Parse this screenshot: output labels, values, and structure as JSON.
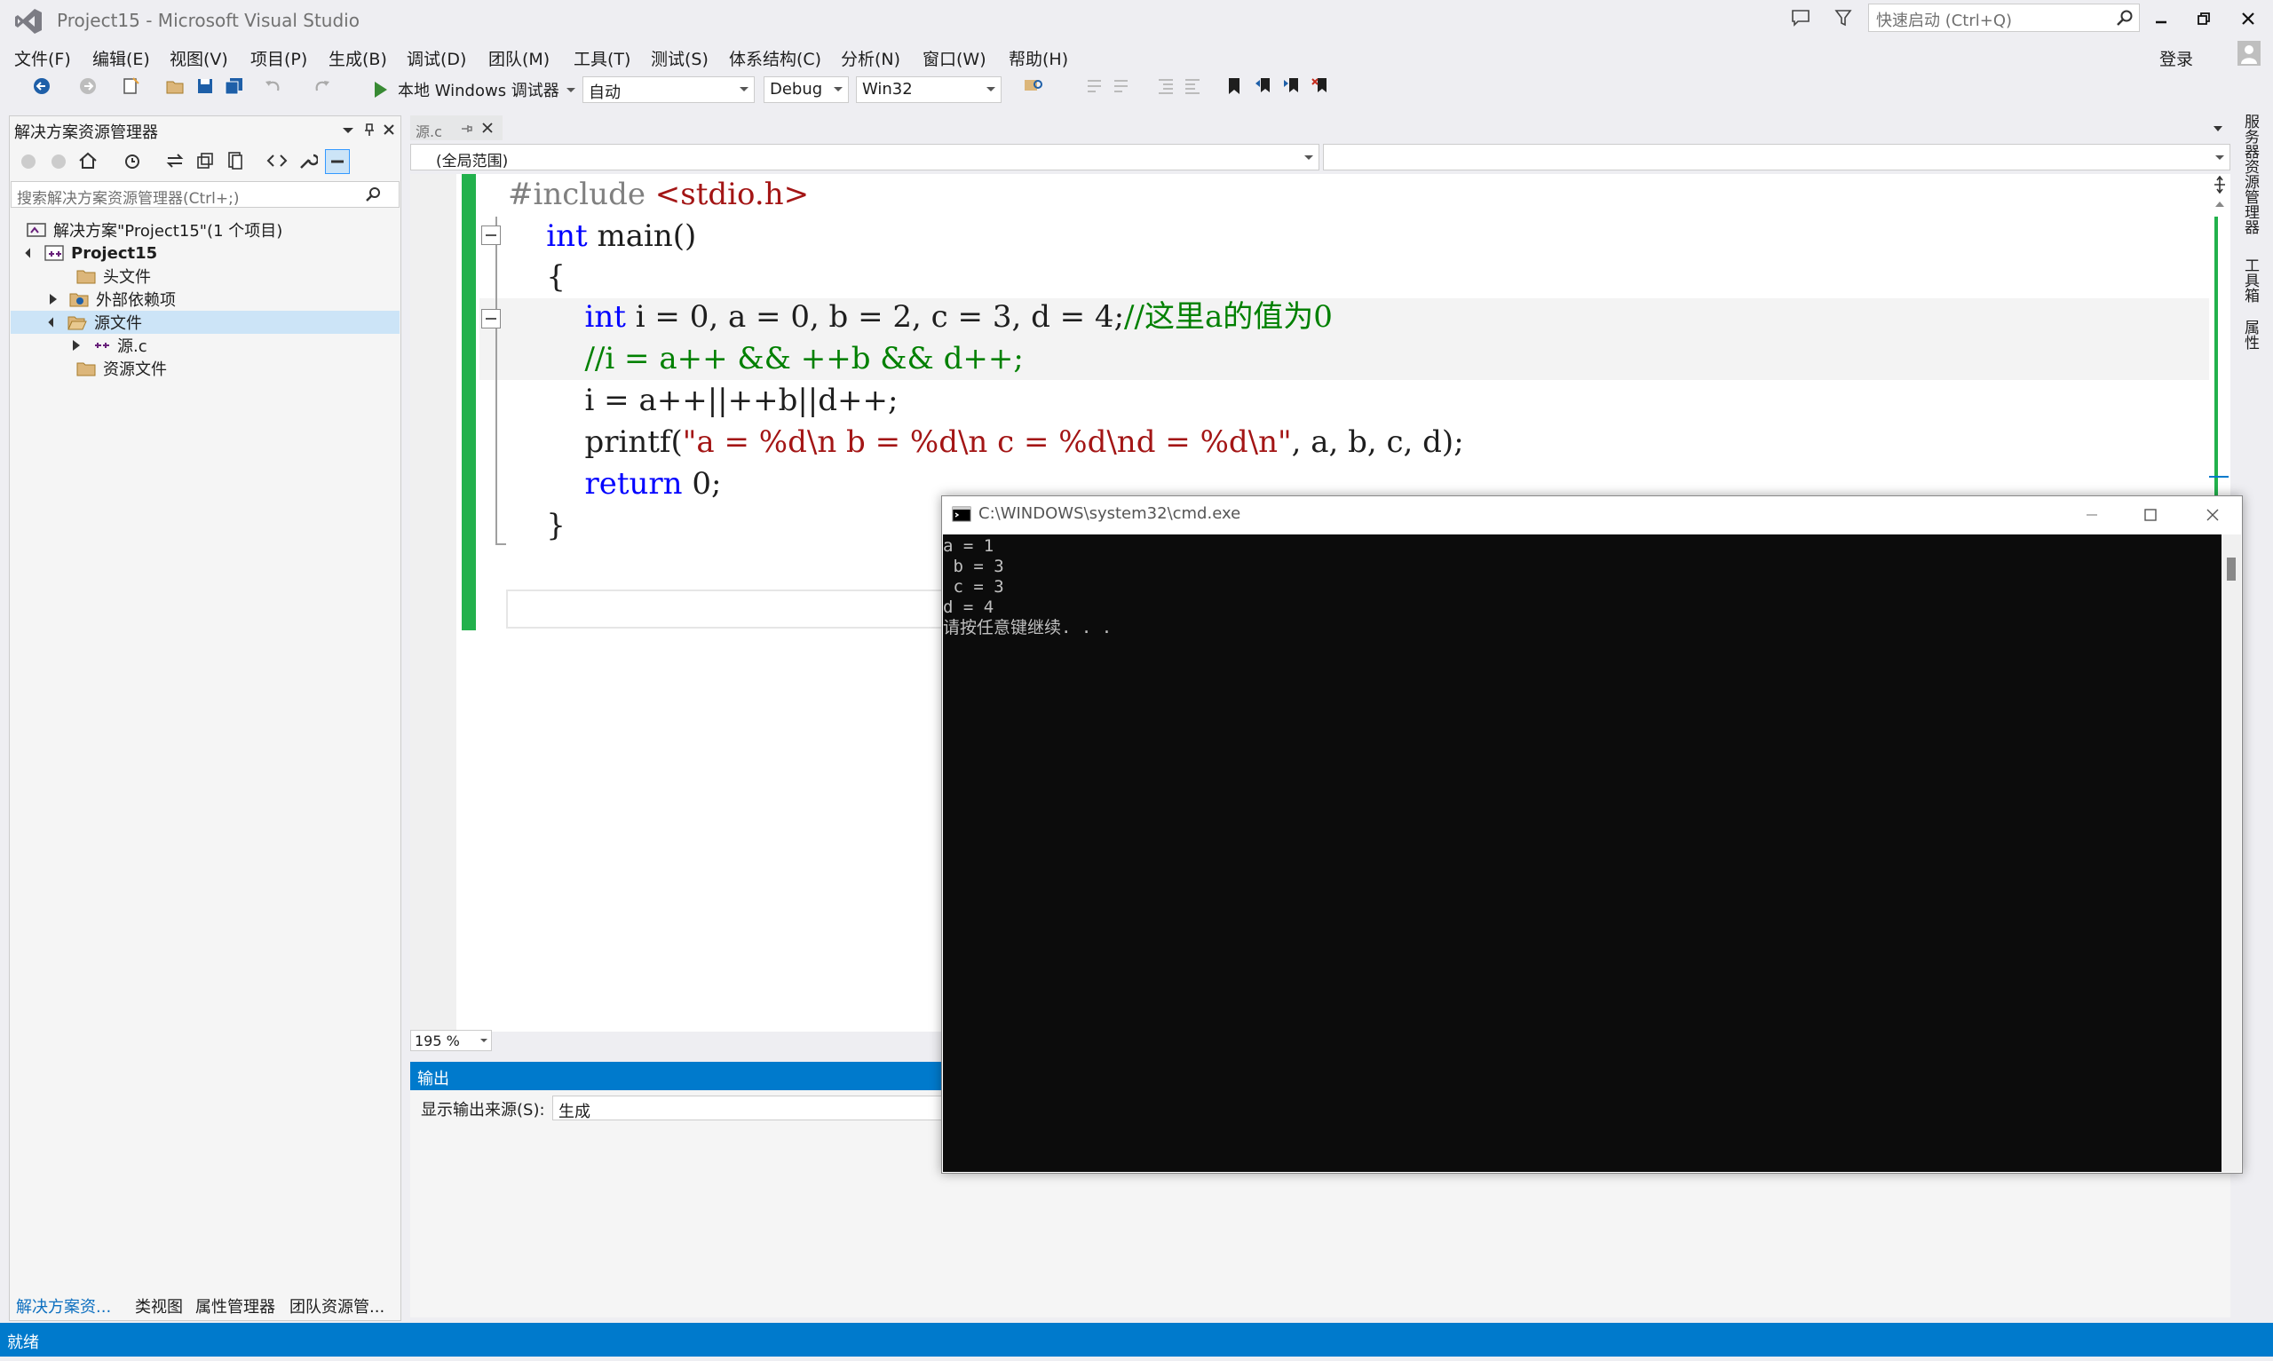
{
  "window": {
    "title": "Project15 - Microsoft Visual Studio"
  },
  "quick_launch": {
    "placeholder": "快速启动 (Ctrl+Q)"
  },
  "menu": [
    "文件(F)",
    "编辑(E)",
    "视图(V)",
    "项目(P)",
    "生成(B)",
    "调试(D)",
    "团队(M)",
    "工具(T)",
    "测试(S)",
    "体系结构(C)",
    "分析(N)",
    "窗口(W)",
    "帮助(H)"
  ],
  "account": {
    "login": "登录"
  },
  "toolbar": {
    "run_label": "本地 Windows 调试器",
    "solution_config": "自动",
    "build_config": "Debug",
    "platform": "Win32"
  },
  "solution_explorer": {
    "title": "解决方案资源管理器",
    "search_placeholder": "搜索解决方案资源管理器(Ctrl+;)",
    "tree": [
      {
        "label": "解决方案\"Project15\"(1 个项目)"
      },
      {
        "label": "Project15"
      },
      {
        "label": "头文件"
      },
      {
        "label": "外部依赖项"
      },
      {
        "label": "源文件"
      },
      {
        "label": "源.c"
      },
      {
        "label": "资源文件"
      }
    ],
    "tabs": [
      "解决方案资...",
      "类视图",
      "属性管理器",
      "团队资源管..."
    ]
  },
  "editor": {
    "tab": "源.c",
    "scope": "(全局范围)",
    "zoom": "195 %",
    "code": {
      "include": "#include",
      "header": "<stdio.h>",
      "int_kw": "int",
      "main_sig": " main()",
      "open_brace": "{",
      "decl_kw": "int",
      "decl_rest": " i = 0, a = 0, b = 2, c = 3, d = 4;",
      "decl_comment": "//这里a的值为0",
      "comment_line": "//i = a++ && ++b && d++;",
      "expr_line": "i = a++||++b||d++;",
      "printf_fn": "printf(",
      "printf_fmt": "\"a = %d\\n b = %d\\n c = %d\\nd = %d\\n\"",
      "printf_args": ", a, b, c, d);",
      "return_kw": "return",
      "return_rest": " 0;",
      "close_brace": "}"
    }
  },
  "output": {
    "title": "输出",
    "source_label": "显示输出来源(S):",
    "source_value": "生成"
  },
  "right_rail": [
    "服务器资源管理器",
    "工具箱",
    "属性"
  ],
  "status": {
    "text": "就绪"
  },
  "console": {
    "title": "C:\\WINDOWS\\system32\\cmd.exe",
    "output": "a = 1\n b = 3\n c = 3\nd = 4\n请按任意键继续. . ."
  }
}
